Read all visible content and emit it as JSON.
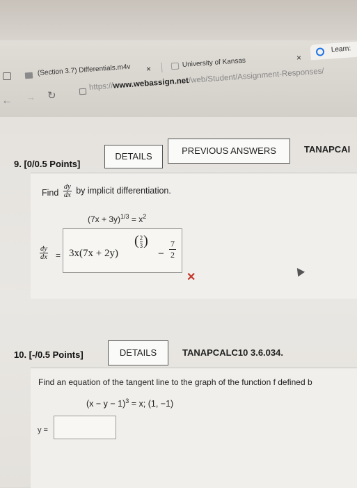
{
  "browser": {
    "tab1_title": "(Section 3.7) Differentials.m4v",
    "tab1_close": "×",
    "tab2_title": "University of Kansas",
    "tab2_close": "×",
    "tab3_title": "Learn:",
    "url_prefix": "https://",
    "url_host": "www.webassign.net",
    "url_path": "/web/Student/Assignment-Responses/"
  },
  "q9": {
    "number": "9. [0/0.5 Points]",
    "details": "DETAILS",
    "previous": "PREVIOUS ANSWERS",
    "course": "TANAPCAI",
    "find": "Find",
    "frac_num": "dy",
    "frac_den": "dx",
    "by_text": "by implicit differentiation.",
    "equation": "(7x + 3y)^1/3 = x^2",
    "eq_lhs": "(7x + 3y)",
    "eq_exp": "1/3",
    "eq_rhs": "= x",
    "eq_rhs_exp": "2",
    "ans_num": "dy",
    "ans_den": "dx",
    "ans_eq": "=",
    "answer_main": "3x(7x + 2y)",
    "answer_exp_num": "2",
    "answer_exp_den": "3",
    "answer_minus": "−",
    "answer_frac_num": "7",
    "answer_frac_den": "2",
    "status_mark": "✕"
  },
  "q10": {
    "number": "10. [-/0.5 Points]",
    "details": "DETAILS",
    "code": "TANAPCALC10 3.6.034.",
    "prompt": "Find an equation of the tangent line to the graph of the function f defined b",
    "equation": "(x − y − 1)^3 = x; (1, −1)",
    "eq_lhs": "(x − y − 1)",
    "eq_exp": "3",
    "eq_rhs": "= x; (1, −1)",
    "y_label": "y =",
    "y_value": ""
  },
  "colors": {
    "error_red": "#c0392b",
    "accent_blue": "#1a73e8"
  }
}
